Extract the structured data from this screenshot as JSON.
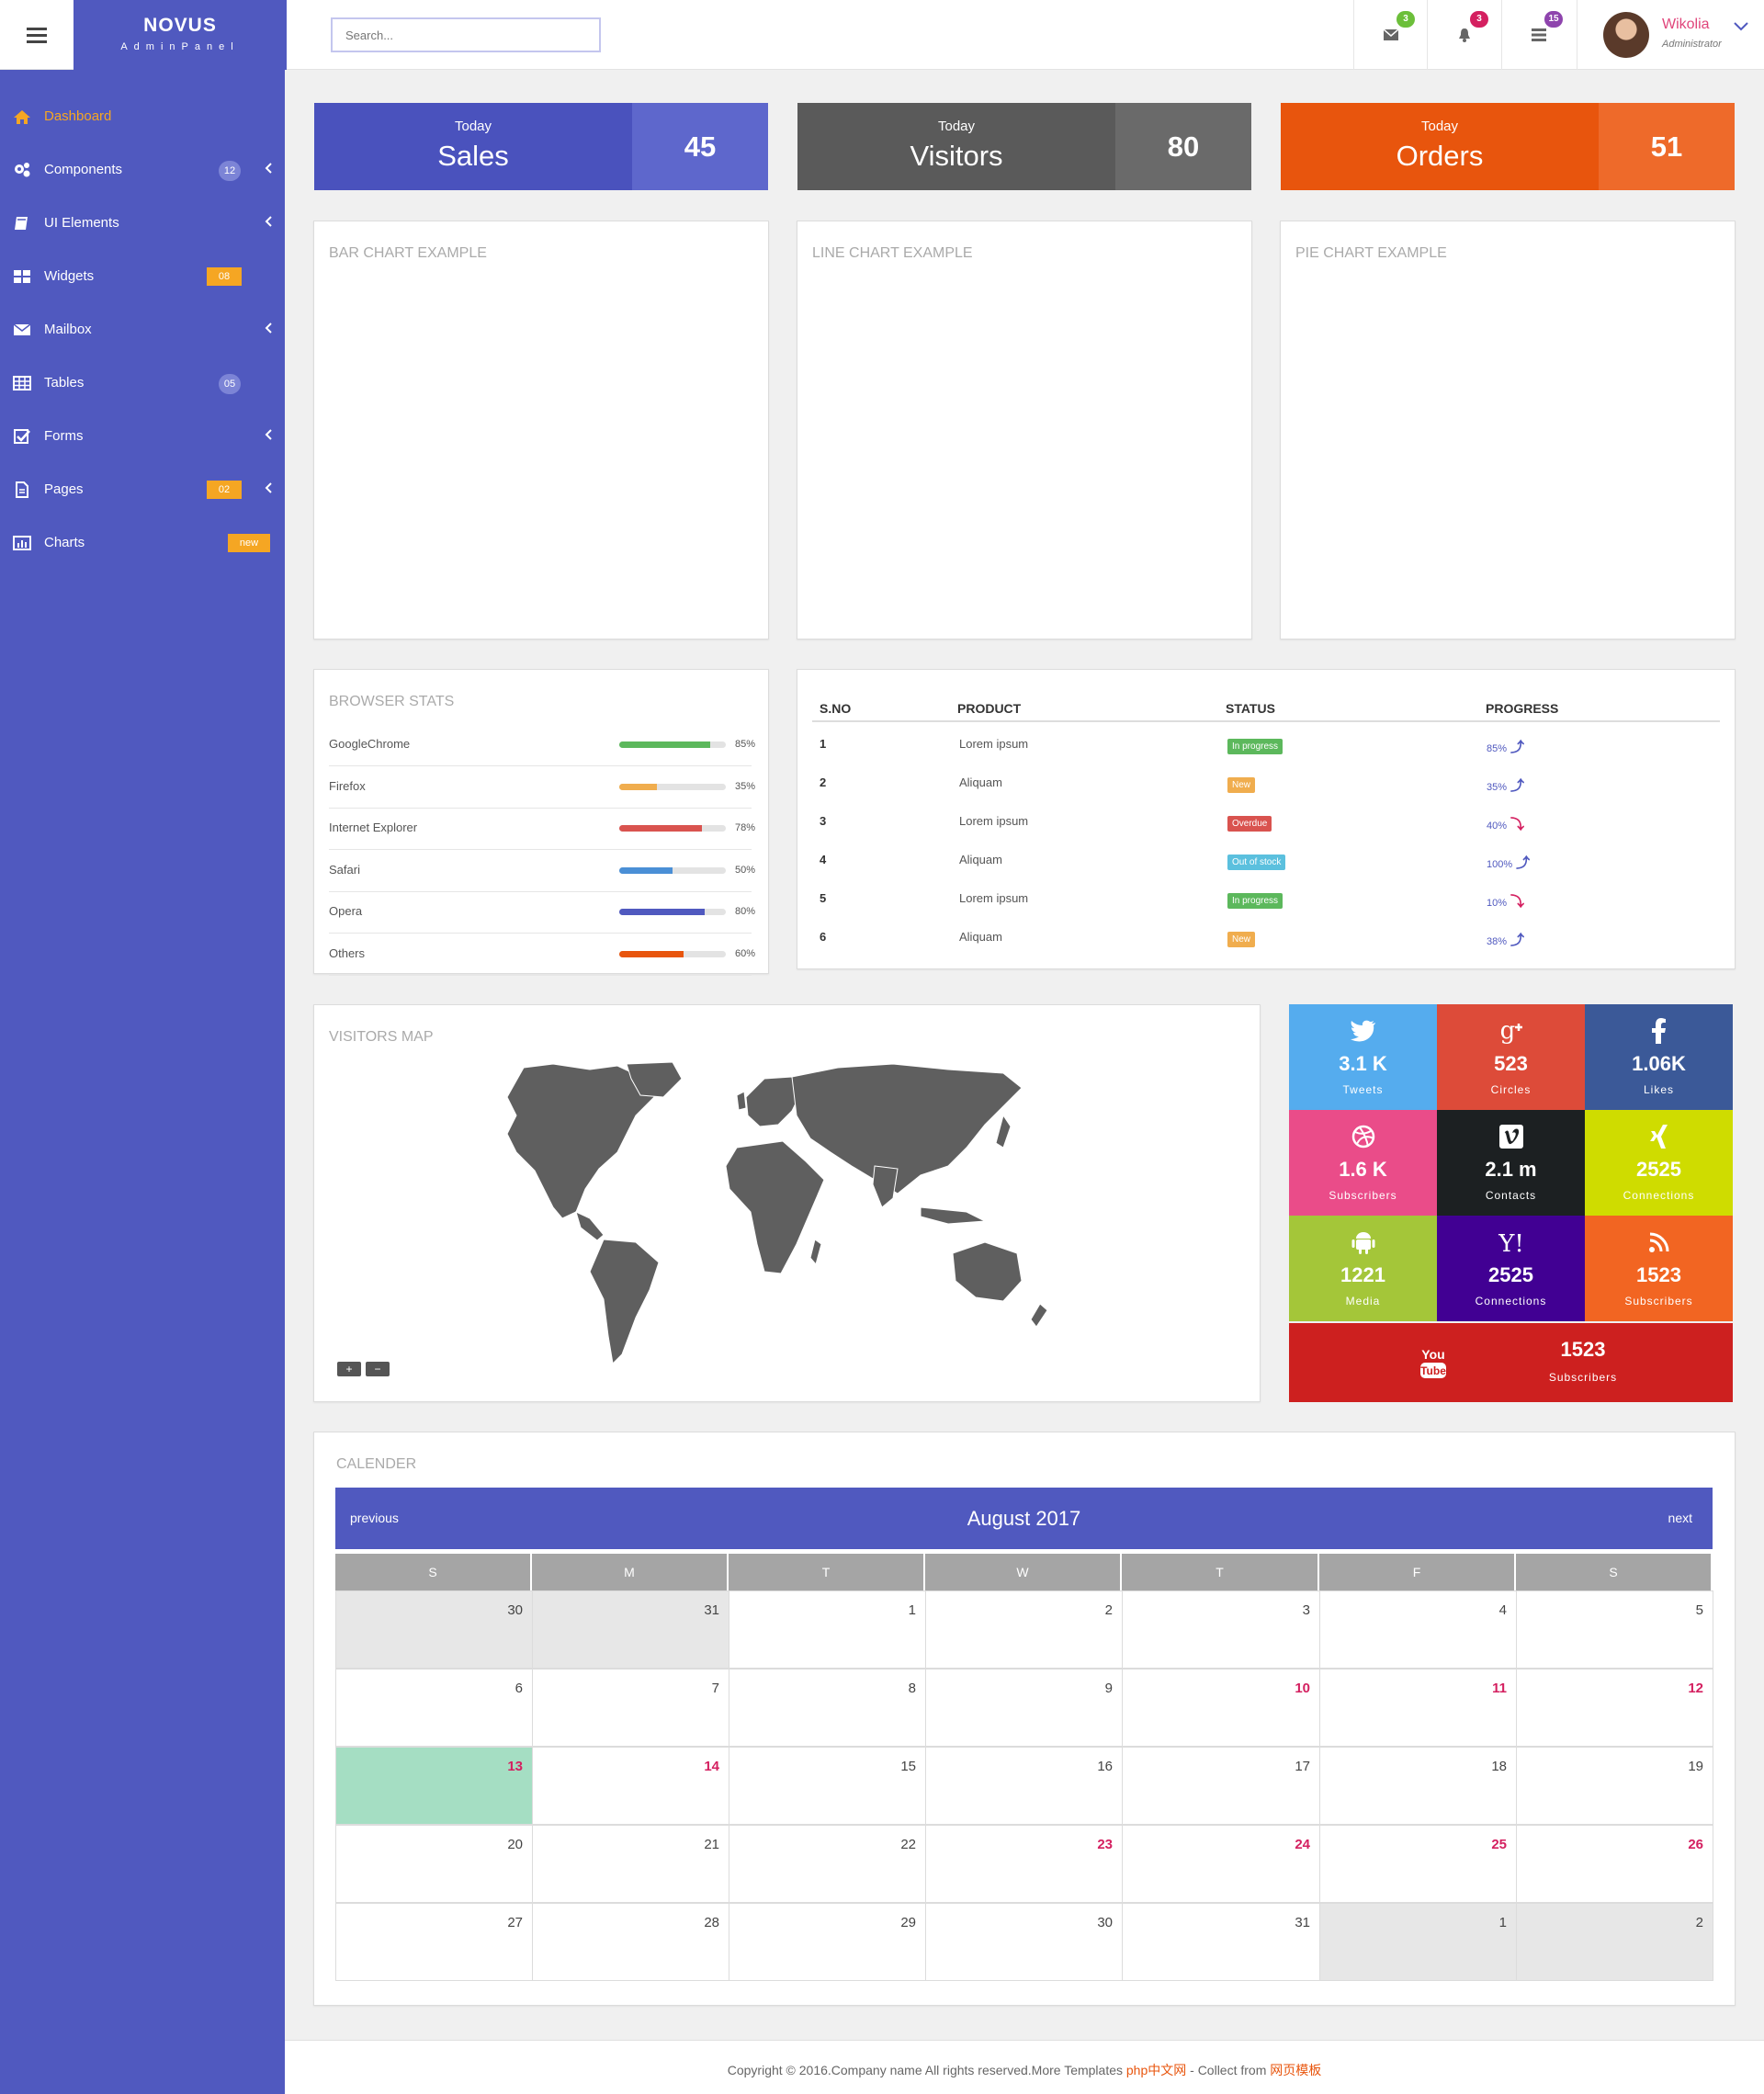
{
  "brand": {
    "name": "NOVUS",
    "sub": "AdminPanel"
  },
  "search": {
    "placeholder": "Search..."
  },
  "topbar": {
    "mail_badge": "3",
    "bell_badge": "3",
    "tasks_badge": "15",
    "user_name": "Wikolia",
    "user_role": "Administrator"
  },
  "sidebar": {
    "items": [
      {
        "label": "Dashboard",
        "icon": "home-icon"
      },
      {
        "label": "Components",
        "icon": "cogs-icon",
        "badge": "12"
      },
      {
        "label": "UI Elements",
        "icon": "book-icon"
      },
      {
        "label": "Widgets",
        "icon": "grid-icon",
        "badge": "08"
      },
      {
        "label": "Mailbox",
        "icon": "envelope-icon"
      },
      {
        "label": "Tables",
        "icon": "table-icon",
        "badge": "05"
      },
      {
        "label": "Forms",
        "icon": "check-square-icon"
      },
      {
        "label": "Pages",
        "icon": "file-icon",
        "badge": "02"
      },
      {
        "label": "Charts",
        "icon": "bar-chart-icon",
        "badge": "new"
      }
    ]
  },
  "stats": [
    {
      "today": "Today",
      "label": "Sales",
      "value": "45",
      "color": "#4a52bd",
      "accent": "#5e67cc"
    },
    {
      "today": "Today",
      "label": "Visitors",
      "value": "80",
      "color": "#5a5a5a",
      "accent": "#6a6a6a"
    },
    {
      "today": "Today",
      "label": "Orders",
      "value": "51",
      "color": "#e8550d",
      "accent": "#ee6a2a"
    }
  ],
  "panels": {
    "bar": "BAR CHART EXAMPLE",
    "line": "LINE CHART EXAMPLE",
    "pie": "PIE CHART EXAMPLE",
    "browser": "BROWSER STATS",
    "map": "VISITORS MAP",
    "calendar": "CALENDER"
  },
  "browsers": [
    {
      "name": "GoogleChrome",
      "pct": "85%",
      "value": 85,
      "color": "#5cb85c"
    },
    {
      "name": "Firefox",
      "pct": "35%",
      "value": 35,
      "color": "#f0ad4e"
    },
    {
      "name": "Internet Explorer",
      "pct": "78%",
      "value": 78,
      "color": "#d9534f"
    },
    {
      "name": "Safari",
      "pct": "50%",
      "value": 50,
      "color": "#4a8fd6"
    },
    {
      "name": "Opera",
      "pct": "80%",
      "value": 80,
      "color": "#5059bf"
    },
    {
      "name": "Others",
      "pct": "60%",
      "value": 60,
      "color": "#e8550d"
    }
  ],
  "table": {
    "headers": [
      "S.NO",
      "PRODUCT",
      "STATUS",
      "PROGRESS"
    ],
    "rows": [
      {
        "no": "1",
        "product": "Lorem ipsum",
        "status": "In progress",
        "status_color": "#5cb85c",
        "progress": "85%",
        "dir": "up"
      },
      {
        "no": "2",
        "product": "Aliquam",
        "status": "New",
        "status_color": "#f0ad4e",
        "progress": "35%",
        "dir": "up"
      },
      {
        "no": "3",
        "product": "Lorem ipsum",
        "status": "Overdue",
        "status_color": "#d9534f",
        "progress": "40%",
        "dir": "down"
      },
      {
        "no": "4",
        "product": "Aliquam",
        "status": "Out of stock",
        "status_color": "#5bc0de",
        "progress": "100%",
        "dir": "up"
      },
      {
        "no": "5",
        "product": "Lorem ipsum",
        "status": "In progress",
        "status_color": "#5cb85c",
        "progress": "10%",
        "dir": "down"
      },
      {
        "no": "6",
        "product": "Aliquam",
        "status": "New",
        "status_color": "#f0ad4e",
        "progress": "38%",
        "dir": "up"
      }
    ]
  },
  "map": {
    "zoom_in": "+",
    "zoom_out": "−"
  },
  "social": [
    {
      "value": "3.1 K",
      "label": "Tweets",
      "icon": "twitter-icon",
      "color": "#55acee"
    },
    {
      "value": "523",
      "label": "Circles",
      "icon": "google-plus-icon",
      "color": "#dd4b39"
    },
    {
      "value": "1.06K",
      "label": "Likes",
      "icon": "facebook-icon",
      "color": "#3b5998"
    },
    {
      "value": "1.6 K",
      "label": "Subscribers",
      "icon": "dribbble-icon",
      "color": "#ea4c89"
    },
    {
      "value": "2.1 m",
      "label": "Contacts",
      "icon": "vimeo-icon",
      "color": "#1c2022"
    },
    {
      "value": "2525",
      "label": "Connections",
      "icon": "xing-icon",
      "color": "#cfdc00"
    },
    {
      "value": "1221",
      "label": "Media",
      "icon": "android-icon",
      "color": "#a4c639"
    },
    {
      "value": "2525",
      "label": "Connections",
      "icon": "yahoo-icon",
      "color": "#410093"
    },
    {
      "value": "1523",
      "label": "Subscribers",
      "icon": "rss-icon",
      "color": "#f26522"
    },
    {
      "value": "1523",
      "label": "Subscribers",
      "icon": "youtube-icon",
      "color": "#cd201f"
    }
  ],
  "calendar": {
    "prev": "previous",
    "next": "next",
    "month": "August 2017",
    "days": [
      "S",
      "M",
      "T",
      "W",
      "T",
      "F",
      "S"
    ],
    "weeks": [
      [
        {
          "d": "30",
          "o": true
        },
        {
          "d": "31",
          "o": true
        },
        {
          "d": "1"
        },
        {
          "d": "2"
        },
        {
          "d": "3"
        },
        {
          "d": "4"
        },
        {
          "d": "5"
        }
      ],
      [
        {
          "d": "6"
        },
        {
          "d": "7"
        },
        {
          "d": "8"
        },
        {
          "d": "9"
        },
        {
          "d": "10",
          "h": true
        },
        {
          "d": "11",
          "h": true
        },
        {
          "d": "12",
          "h": true
        }
      ],
      [
        {
          "d": "13",
          "h": true,
          "t": true
        },
        {
          "d": "14",
          "h": true
        },
        {
          "d": "15"
        },
        {
          "d": "16"
        },
        {
          "d": "17"
        },
        {
          "d": "18"
        },
        {
          "d": "19"
        }
      ],
      [
        {
          "d": "20"
        },
        {
          "d": "21"
        },
        {
          "d": "22"
        },
        {
          "d": "23",
          "h": true
        },
        {
          "d": "24",
          "h": true
        },
        {
          "d": "25",
          "h": true
        },
        {
          "d": "26",
          "h": true
        }
      ],
      [
        {
          "d": "27"
        },
        {
          "d": "28"
        },
        {
          "d": "29"
        },
        {
          "d": "30"
        },
        {
          "d": "31"
        },
        {
          "d": "1",
          "o": true
        },
        {
          "d": "2",
          "o": true
        }
      ]
    ]
  },
  "footer": {
    "text": "Copyright © 2016.Company name All rights reserved.More Templates ",
    "link1": "php中文网",
    "mid": " - Collect from ",
    "link2": "网页模板"
  }
}
